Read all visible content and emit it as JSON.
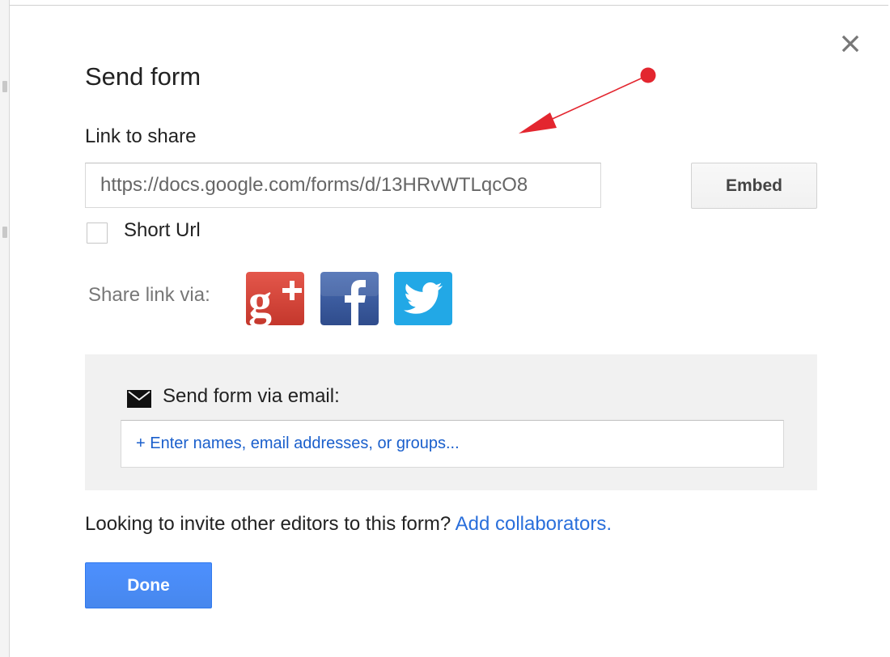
{
  "dialog": {
    "title": "Send form",
    "close_icon": "close-icon"
  },
  "link": {
    "label": "Link to share",
    "url_value": "https://docs.google.com/forms/d/13HRvWTLqcO8",
    "embed_label": "Embed",
    "short_url_label": "Short Url",
    "short_url_checked": false
  },
  "share": {
    "label": "Share link via:",
    "icons": [
      "google-plus-icon",
      "facebook-icon",
      "twitter-icon"
    ],
    "colors": {
      "google_plus": "#d73d32",
      "facebook": "#3b5998",
      "twitter": "#1da1f2"
    }
  },
  "email": {
    "label": "Send form via email:",
    "icon": "mail-icon",
    "placeholder": "+ Enter names, email addresses, or groups..."
  },
  "invite": {
    "text": "Looking to invite other editors to this form?",
    "link_text": "Add collaborators."
  },
  "footer": {
    "done_label": "Done"
  },
  "colors": {
    "primary_button": "#4d90fe",
    "link": "#2a6fdb",
    "annotation": "#e3262f"
  }
}
